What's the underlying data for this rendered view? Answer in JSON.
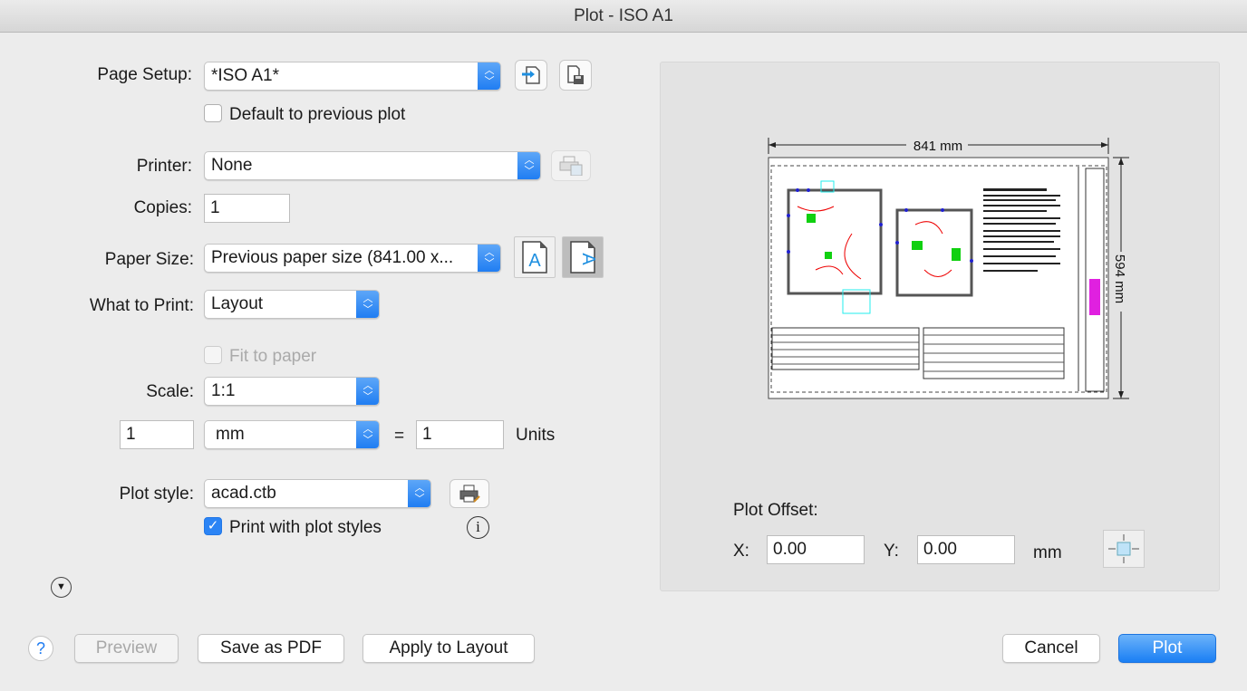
{
  "window": {
    "title": "Plot - ISO A1"
  },
  "page_setup": {
    "label": "Page Setup:",
    "value": "*ISO A1*",
    "default_prev_label": "Default to previous plot",
    "default_prev_checked": false
  },
  "printer": {
    "label": "Printer:",
    "value": "None"
  },
  "copies": {
    "label": "Copies:",
    "value": "1"
  },
  "paper_size": {
    "label": "Paper Size:",
    "value": "Previous paper size (841.00 x...",
    "orientation": "landscape"
  },
  "what_to_print": {
    "label": "What to Print:",
    "value": "Layout"
  },
  "fit_to_paper": {
    "label": "Fit to paper",
    "checked": false,
    "disabled": true
  },
  "scale": {
    "label": "Scale:",
    "value": "1:1",
    "left_value": "1",
    "unit": "mm",
    "equals": "=",
    "right_value": "1",
    "units_label": "Units"
  },
  "plot_style": {
    "label": "Plot style:",
    "value": "acad.ctb",
    "print_with_label": "Print with plot styles",
    "print_with_checked": true
  },
  "preview": {
    "width_label": "841 mm",
    "height_label": "594 mm"
  },
  "plot_offset": {
    "title": "Plot Offset:",
    "x_label": "X:",
    "x_value": "0.00",
    "y_label": "Y:",
    "y_value": "0.00",
    "unit": "mm"
  },
  "buttons": {
    "help": "?",
    "preview": "Preview",
    "save_pdf": "Save as PDF",
    "apply": "Apply to Layout",
    "cancel": "Cancel",
    "plot": "Plot"
  },
  "colors": {
    "accent": "#1e7cf2",
    "background": "#ececec"
  }
}
